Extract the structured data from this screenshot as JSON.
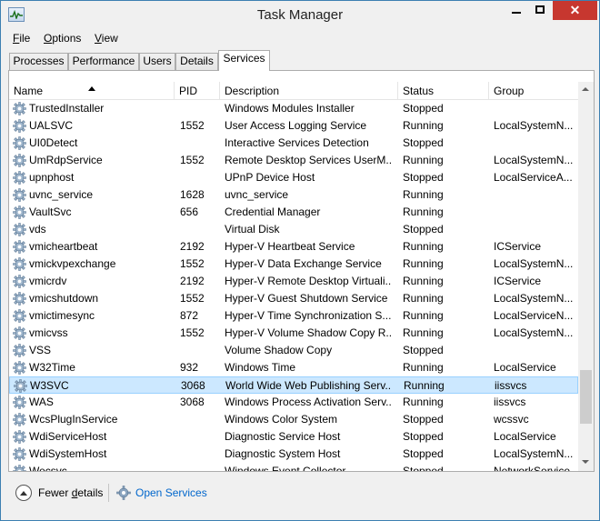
{
  "window": {
    "title": "Task Manager",
    "close_glyph": "✕"
  },
  "menu": [
    {
      "label": "File",
      "accel": "F"
    },
    {
      "label": "Options",
      "accel": "O"
    },
    {
      "label": "View",
      "accel": "V"
    }
  ],
  "tabs": [
    {
      "label": "Processes"
    },
    {
      "label": "Performance"
    },
    {
      "label": "Users"
    },
    {
      "label": "Details"
    },
    {
      "label": "Services",
      "active": true
    }
  ],
  "columns": {
    "name": "Name",
    "pid": "PID",
    "description": "Description",
    "status": "Status",
    "group": "Group"
  },
  "sort": {
    "column": "Name",
    "direction": "ascending"
  },
  "services": [
    {
      "name": "TrustedInstaller",
      "pid": "",
      "description": "Windows Modules Installer",
      "status": "Stopped",
      "group": ""
    },
    {
      "name": "UALSVC",
      "pid": "1552",
      "description": "User Access Logging Service",
      "status": "Running",
      "group": "LocalSystemN..."
    },
    {
      "name": "UI0Detect",
      "pid": "",
      "description": "Interactive Services Detection",
      "status": "Stopped",
      "group": ""
    },
    {
      "name": "UmRdpService",
      "pid": "1552",
      "description": "Remote Desktop Services UserM...",
      "status": "Running",
      "group": "LocalSystemN..."
    },
    {
      "name": "upnphost",
      "pid": "",
      "description": "UPnP Device Host",
      "status": "Stopped",
      "group": "LocalServiceA..."
    },
    {
      "name": "uvnc_service",
      "pid": "1628",
      "description": "uvnc_service",
      "status": "Running",
      "group": ""
    },
    {
      "name": "VaultSvc",
      "pid": "656",
      "description": "Credential Manager",
      "status": "Running",
      "group": ""
    },
    {
      "name": "vds",
      "pid": "",
      "description": "Virtual Disk",
      "status": "Stopped",
      "group": ""
    },
    {
      "name": "vmicheartbeat",
      "pid": "2192",
      "description": "Hyper-V Heartbeat Service",
      "status": "Running",
      "group": "ICService"
    },
    {
      "name": "vmickvpexchange",
      "pid": "1552",
      "description": "Hyper-V Data Exchange Service",
      "status": "Running",
      "group": "LocalSystemN..."
    },
    {
      "name": "vmicrdv",
      "pid": "2192",
      "description": "Hyper-V Remote Desktop Virtuali...",
      "status": "Running",
      "group": "ICService"
    },
    {
      "name": "vmicshutdown",
      "pid": "1552",
      "description": "Hyper-V Guest Shutdown Service",
      "status": "Running",
      "group": "LocalSystemN..."
    },
    {
      "name": "vmictimesync",
      "pid": "872",
      "description": "Hyper-V Time Synchronization S...",
      "status": "Running",
      "group": "LocalServiceN..."
    },
    {
      "name": "vmicvss",
      "pid": "1552",
      "description": "Hyper-V Volume Shadow Copy R...",
      "status": "Running",
      "group": "LocalSystemN..."
    },
    {
      "name": "VSS",
      "pid": "",
      "description": "Volume Shadow Copy",
      "status": "Stopped",
      "group": ""
    },
    {
      "name": "W32Time",
      "pid": "932",
      "description": "Windows Time",
      "status": "Running",
      "group": "LocalService"
    },
    {
      "name": "W3SVC",
      "pid": "3068",
      "description": "World Wide Web Publishing Serv...",
      "status": "Running",
      "group": "iissvcs",
      "selected": true
    },
    {
      "name": "WAS",
      "pid": "3068",
      "description": "Windows Process Activation Serv...",
      "status": "Running",
      "group": "iissvcs"
    },
    {
      "name": "WcsPlugInService",
      "pid": "",
      "description": "Windows Color System",
      "status": "Stopped",
      "group": "wcssvc"
    },
    {
      "name": "WdiServiceHost",
      "pid": "",
      "description": "Diagnostic Service Host",
      "status": "Stopped",
      "group": "LocalService"
    },
    {
      "name": "WdiSystemHost",
      "pid": "",
      "description": "Diagnostic System Host",
      "status": "Stopped",
      "group": "LocalSystemN..."
    },
    {
      "name": "Wecsvc",
      "pid": "",
      "description": "Windows Event Collector",
      "status": "Stopped",
      "group": "NetworkService"
    }
  ],
  "footer": {
    "fewer_details": "Fewer details",
    "fewer_accel": "d",
    "open_services": "Open Services"
  },
  "colors": {
    "selection": "#cce8ff",
    "selection_border": "#99d1ff",
    "link": "#0066cc",
    "close_button": "#c7372f",
    "window_border": "#3c7fb1"
  },
  "icons": {
    "app": "task-manager-icon",
    "service": "gear-icon",
    "collapse": "chevron-up-circle-icon",
    "open_services": "services-gear-icon"
  }
}
